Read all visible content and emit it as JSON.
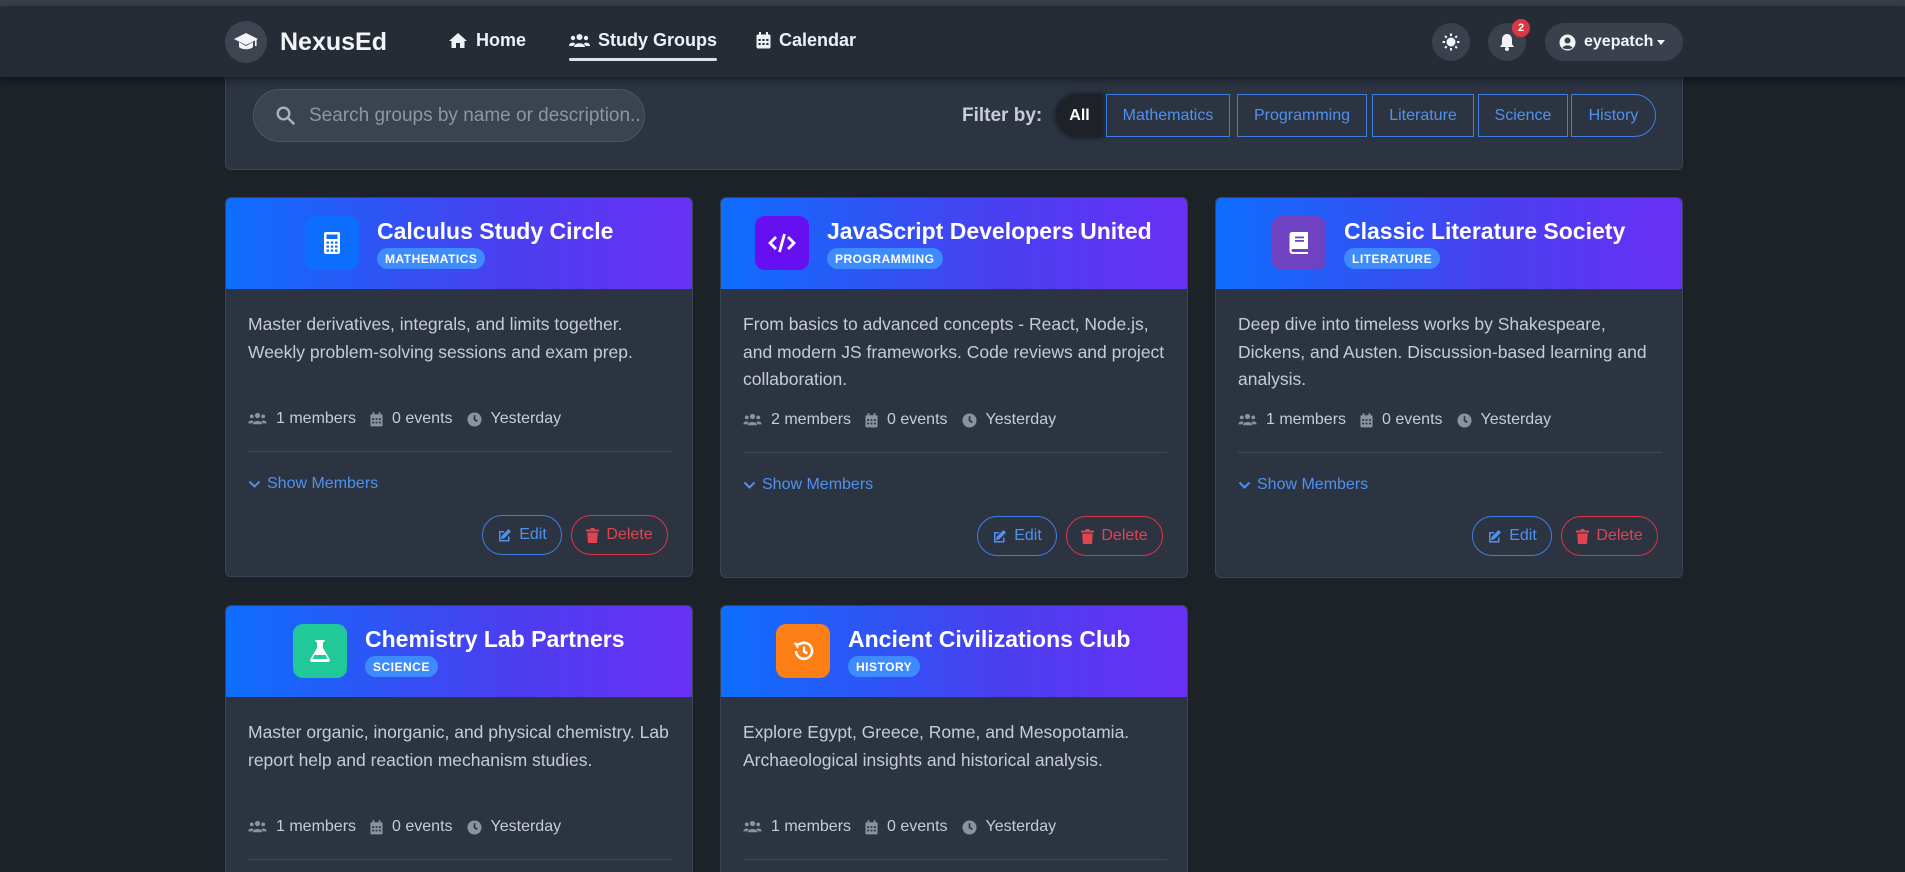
{
  "app": {
    "brand": "NexusEd"
  },
  "nav": {
    "items": [
      {
        "label": "Home",
        "icon": "home-icon"
      },
      {
        "label": "Study Groups",
        "icon": "users-icon",
        "active": true
      },
      {
        "label": "Calendar",
        "icon": "calendar-icon"
      }
    ],
    "notifications_count": "2",
    "user": "eyepatch"
  },
  "filters": {
    "search_placeholder": "Search groups by name or description...",
    "label": "Filter by:",
    "chips": [
      "All",
      "Mathematics",
      "Programming",
      "Literature",
      "Science",
      "History"
    ],
    "selected": "All"
  },
  "groups": [
    {
      "title": "Calculus Study Circle",
      "category": "MATHEMATICS",
      "icon": "calculator-icon",
      "icon_color": "#0d6efd",
      "description": "Master derivatives, integrals, and limits together. Weekly problem-solving sessions and exam prep.",
      "members": "1 members",
      "events": "0 events",
      "updated": "Yesterday",
      "show_members": "Show Members",
      "edit": "Edit",
      "delete": "Delete"
    },
    {
      "title": "JavaScript Developers United",
      "category": "PROGRAMMING",
      "icon": "code-icon",
      "icon_color": "#6610f2",
      "description": "From basics to advanced concepts - React, Node.js, and modern JS frameworks. Code reviews and project collaboration.",
      "members": "2 members",
      "events": "0 events",
      "updated": "Yesterday",
      "show_members": "Show Members",
      "edit": "Edit",
      "delete": "Delete"
    },
    {
      "title": "Classic Literature Society",
      "category": "LITERATURE",
      "icon": "book-icon",
      "icon_color": "#6f42c1",
      "description": "Deep dive into timeless works by Shakespeare, Dickens, and Austen. Discussion-based learning and analysis.",
      "members": "1 members",
      "events": "0 events",
      "updated": "Yesterday",
      "show_members": "Show Members",
      "edit": "Edit",
      "delete": "Delete"
    },
    {
      "title": "Chemistry Lab Partners",
      "category": "SCIENCE",
      "icon": "flask-icon",
      "icon_color": "#20c997",
      "description": "Master organic, inorganic, and physical chemistry. Lab report help and reaction mechanism studies.",
      "members": "1 members",
      "events": "0 events",
      "updated": "Yesterday"
    },
    {
      "title": "Ancient Civilizations Club",
      "category": "HISTORY",
      "icon": "history-icon",
      "icon_color": "#fd7e14",
      "description": "Explore Egypt, Greece, Rome, and Mesopotamia. Archaeological insights and historical analysis.",
      "members": "1 members",
      "events": "0 events",
      "updated": "Yesterday"
    }
  ]
}
